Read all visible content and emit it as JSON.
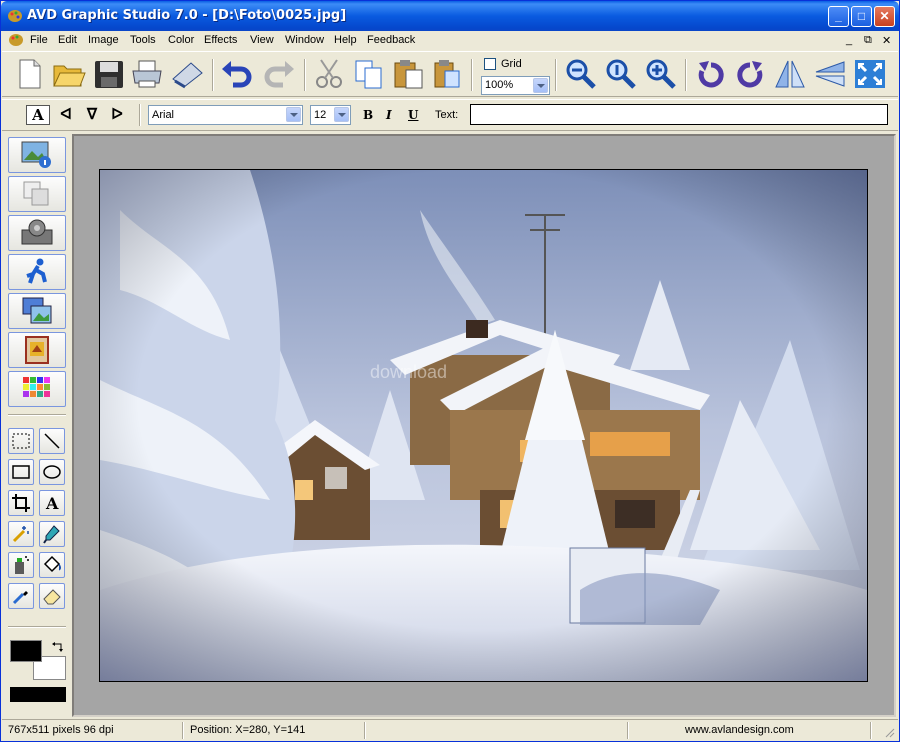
{
  "window": {
    "title": "AVD Graphic Studio 7.0 - [D:\\Foto\\0025.jpg]",
    "controls": {
      "minimize": "_",
      "maximize": "□",
      "close": "✕"
    }
  },
  "menubar": {
    "items": [
      "File",
      "Edit",
      "Image",
      "Tools",
      "Color",
      "Effects",
      "View",
      "Window",
      "Help",
      "Feedback"
    ],
    "mdi": {
      "minimize": "_",
      "restore": "⧉",
      "close": "✕"
    }
  },
  "toolbar": {
    "grid_label": "Grid",
    "grid_checked": false,
    "zoom_value": "100%",
    "icons": [
      "new-icon",
      "open-icon",
      "save-icon",
      "print-icon",
      "scan-icon",
      "undo-icon",
      "redo-icon",
      "cut-icon",
      "copy-icon",
      "paste-icon",
      "paste-new-icon",
      "zoom-out-icon",
      "zoom-actual-icon",
      "zoom-in-icon",
      "rotate-left-icon",
      "rotate-right-icon",
      "flip-horizontal-icon",
      "flip-vertical-icon",
      "fit-window-icon"
    ]
  },
  "text_toolbar": {
    "align_buttons": [
      "A",
      "ᐊ",
      "ᐁ",
      "ᐅ"
    ],
    "font_value": "Arial",
    "size_value": "12",
    "bold": "B",
    "italic": "I",
    "underline": "U",
    "text_label": "Text:",
    "text_value": ""
  },
  "left_panel": {
    "big_buttons": [
      "image-info-icon",
      "layers-icon",
      "film-icon",
      "runner-icon",
      "slideshow-icon",
      "frame-icon",
      "palette-grid-icon"
    ],
    "tools": [
      "rect-select-icon",
      "line-icon",
      "rectangle-icon",
      "ellipse-icon",
      "crop-icon",
      "text-tool-icon",
      "magic-wand-icon",
      "dropper-fill-icon",
      "spray-icon",
      "fill-bucket-icon",
      "eyedropper-icon",
      "eraser-icon"
    ],
    "colors": {
      "foreground": "#000000",
      "background": "#ffffff"
    }
  },
  "statusbar": {
    "size": "767x511 pixels  96 dpi",
    "position": "Position: X=280, Y=141",
    "website": "www.avlandesign.com"
  },
  "photo": {
    "watermark": "download",
    "alt_desc": "snow-covered-house"
  }
}
